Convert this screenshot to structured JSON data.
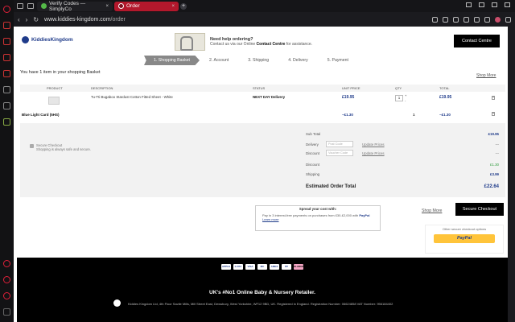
{
  "browser": {
    "tabs": [
      {
        "label": "Verify Codes — SimplyCo",
        "close": "×"
      },
      {
        "label": "Order",
        "close": "×"
      }
    ],
    "new_tab": "+",
    "url_domain": "www.kiddies-kingdom.com",
    "url_path": "/order",
    "back": "‹",
    "forward": "›",
    "reload": "↻"
  },
  "header": {
    "logo": "KiddiesKingdom",
    "help_title": "Need help ordering?",
    "help_prefix": "Contact us via our Online",
    "help_link": "Contact Centre",
    "help_suffix": "for assistance.",
    "contact_button": "Contact Centre"
  },
  "steps": [
    "1. Shopping Basket",
    "2. Account",
    "3. Shipping",
    "4. Delivery",
    "5. Payment"
  ],
  "basket": {
    "heading": "You have 1 item in your shopping Basket",
    "shop_more": "Shop More",
    "columns": [
      "PRODUCT",
      "DESCRIPTION",
      "STATUS",
      "UNIT PRICE",
      "QTY",
      "TOTAL"
    ],
    "item": {
      "description": "Tu-Tti Bugaboo Stardust Cotton Fitted Sheet - White",
      "status": "NEXT DAY Delivery",
      "unit_price": "£19.95",
      "qty": "1",
      "plus": "+",
      "minus": "-",
      "total": "£19.95"
    },
    "card_row": {
      "label": "Blue Light Card (5HS)",
      "unit_price": "−£1.30",
      "qty": "1",
      "total": "−£1.30"
    }
  },
  "summary": {
    "secure_title": "Secure Checkout",
    "secure_sub": "Shopping is always safe and secure.",
    "subtotal_label": "Sub Total",
    "subtotal": "£19.95",
    "delivery_label": "Delivery",
    "delivery_placeholder": "Post Code",
    "delivery_value": "---",
    "discount_code_label": "Discount",
    "voucher_placeholder": "Voucher Code",
    "discount_code_value": "---",
    "update_prices": "Update Prices",
    "discount_label": "Discount",
    "discount": "£1.30",
    "shipping_label": "Shipping",
    "shipping": "£3.99",
    "total_label": "Estimated Order Total",
    "total": "£22.64"
  },
  "spread": {
    "title": "Spread your cost with:",
    "text": "Pay in 3 interest-free payments on purchases from £30-£2,000 with",
    "brand": "PayPal",
    "learn_more": "Learn more"
  },
  "checkout": {
    "shop_more": "Shop More",
    "secure_button": "Secure Checkout",
    "other_options": "Other secure checkout options",
    "paypal_button": "PayPal"
  },
  "footer": {
    "payments": [
      "APPLE",
      "G PAY",
      "VISA",
      "MC",
      "AMEX",
      "PP",
      "KLARNA"
    ],
    "title": "UK's #No1 Online Baby & Nursery Retailer.",
    "address": "Kiddies Kingdom Ltd, 4th Floor Savile Mills, Mill Street East, Dewsbury, West Yorkshire, WF12 9BD, UK. Registered in England. Registration Number: 06624858 VAT Number: 956184402"
  },
  "colors": {
    "brand_blue": "#1f3b8a",
    "tab_active": "#b3182c",
    "paypal_yellow": "#ffc43a",
    "discount_green": "#2e9b3c"
  }
}
